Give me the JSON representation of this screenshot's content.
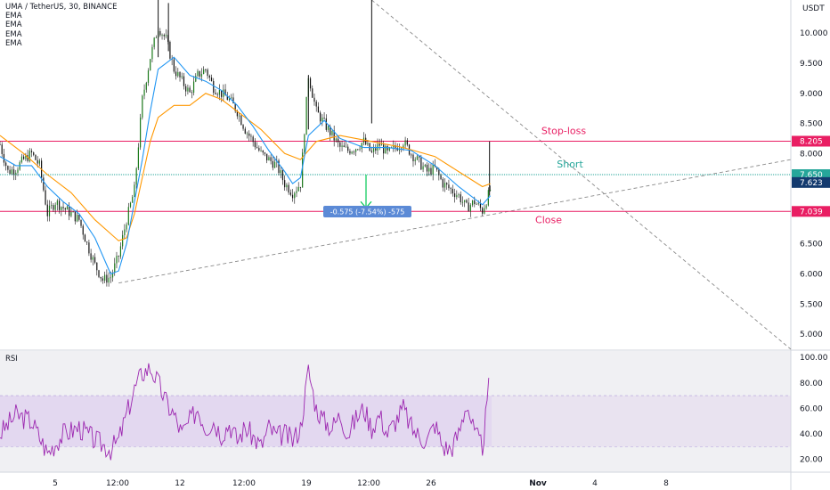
{
  "header": {
    "symbol": "UMA / TetherUS, 30, BINANCE",
    "indicators": [
      "EMA",
      "EMA",
      "EMA",
      "EMA"
    ],
    "currency": "USDT"
  },
  "rsi_panel": {
    "label": "RSI"
  },
  "colors": {
    "candle": "#111111",
    "ema_fast": "#2196f3",
    "ema_slow": "#ff9800",
    "line_red": "#e91e63",
    "line_teal": "#26a69a",
    "rsi_line": "#9c27b0",
    "rsi_band": "#e1d3ee",
    "arrow_green": "#00c853",
    "measure_box": "#5b8ad6",
    "label_dark_blue": "#133a6e"
  },
  "chart_data": [
    {
      "type": "candlestick",
      "title": "UMA / TetherUS, 30, BINANCE",
      "ylabel": "USDT",
      "ylim": [
        4.75,
        10.55
      ],
      "y_ticks": [
        "10.000",
        "9.500",
        "9.000",
        "8.500",
        "8.000",
        "7.500",
        "7.000",
        "6.500",
        "6.000",
        "5.500",
        "5.000"
      ],
      "x_tick_labels": [
        "5",
        "12:00",
        "12",
        "12:00",
        "19",
        "12:00",
        "26",
        "Nov",
        "4",
        "8"
      ],
      "price_path": [
        {
          "t": 0,
          "p": 8.15
        },
        {
          "t": 1,
          "p": 7.7
        },
        {
          "t": 2,
          "p": 7.75
        },
        {
          "t": 3,
          "p": 7.9
        },
        {
          "t": 4,
          "p": 8.0
        },
        {
          "t": 5,
          "p": 7.8
        },
        {
          "t": 6,
          "p": 7.0
        },
        {
          "t": 7,
          "p": 7.2
        },
        {
          "t": 8,
          "p": 7.1
        },
        {
          "t": 9,
          "p": 7.0
        },
        {
          "t": 10,
          "p": 6.9
        },
        {
          "t": 11,
          "p": 6.5
        },
        {
          "t": 12,
          "p": 6.15
        },
        {
          "t": 13,
          "p": 5.9
        },
        {
          "t": 14,
          "p": 5.95
        },
        {
          "t": 15,
          "p": 6.3
        },
        {
          "t": 16,
          "p": 6.9
        },
        {
          "t": 17,
          "p": 7.4
        },
        {
          "t": 18,
          "p": 8.9
        },
        {
          "t": 19,
          "p": 9.6
        },
        {
          "t": 20,
          "p": 10.1
        },
        {
          "t": 21,
          "p": 9.9
        },
        {
          "t": 22,
          "p": 9.4
        },
        {
          "t": 23,
          "p": 9.2
        },
        {
          "t": 24,
          "p": 9.0
        },
        {
          "t": 25,
          "p": 9.3
        },
        {
          "t": 26,
          "p": 9.4
        },
        {
          "t": 27,
          "p": 9.1
        },
        {
          "t": 28,
          "p": 9.0
        },
        {
          "t": 29,
          "p": 8.9
        },
        {
          "t": 30,
          "p": 8.7
        },
        {
          "t": 31,
          "p": 8.4
        },
        {
          "t": 32,
          "p": 8.2
        },
        {
          "t": 33,
          "p": 8.0
        },
        {
          "t": 34,
          "p": 7.9
        },
        {
          "t": 35,
          "p": 7.8
        },
        {
          "t": 36,
          "p": 7.5
        },
        {
          "t": 37,
          "p": 7.35
        },
        {
          "t": 38,
          "p": 7.5
        },
        {
          "t": 39,
          "p": 9.3
        },
        {
          "t": 40,
          "p": 8.7
        },
        {
          "t": 41,
          "p": 8.5
        },
        {
          "t": 42,
          "p": 8.3
        },
        {
          "t": 43,
          "p": 8.1
        },
        {
          "t": 44,
          "p": 8.05
        },
        {
          "t": 45,
          "p": 8.1
        },
        {
          "t": 46,
          "p": 8.2
        },
        {
          "t": 47,
          "p": 8.0
        },
        {
          "t": 48,
          "p": 8.15
        },
        {
          "t": 49,
          "p": 8.0
        },
        {
          "t": 50,
          "p": 8.1
        },
        {
          "t": 51,
          "p": 8.2
        },
        {
          "t": 52,
          "p": 8.0
        },
        {
          "t": 53,
          "p": 7.85
        },
        {
          "t": 54,
          "p": 7.7
        },
        {
          "t": 55,
          "p": 7.75
        },
        {
          "t": 56,
          "p": 7.5
        },
        {
          "t": 57,
          "p": 7.4
        },
        {
          "t": 58,
          "p": 7.3
        },
        {
          "t": 59,
          "p": 7.1
        },
        {
          "t": 60,
          "p": 7.2
        },
        {
          "t": 61,
          "p": 7.05
        },
        {
          "t": 62,
          "p": 7.4
        }
      ],
      "ema_fast": [
        {
          "t": 0,
          "p": 7.95
        },
        {
          "t": 2,
          "p": 7.8
        },
        {
          "t": 4,
          "p": 7.8
        },
        {
          "t": 6,
          "p": 7.45
        },
        {
          "t": 8,
          "p": 7.2
        },
        {
          "t": 10,
          "p": 7.0
        },
        {
          "t": 12,
          "p": 6.6
        },
        {
          "t": 14,
          "p": 6.0
        },
        {
          "t": 15,
          "p": 6.05
        },
        {
          "t": 16,
          "p": 6.5
        },
        {
          "t": 17,
          "p": 7.2
        },
        {
          "t": 18,
          "p": 7.9
        },
        {
          "t": 19,
          "p": 8.7
        },
        {
          "t": 20,
          "p": 9.4
        },
        {
          "t": 22,
          "p": 9.6
        },
        {
          "t": 24,
          "p": 9.3
        },
        {
          "t": 26,
          "p": 9.2
        },
        {
          "t": 28,
          "p": 9.05
        },
        {
          "t": 30,
          "p": 8.8
        },
        {
          "t": 32,
          "p": 8.45
        },
        {
          "t": 34,
          "p": 8.05
        },
        {
          "t": 36,
          "p": 7.7
        },
        {
          "t": 37,
          "p": 7.5
        },
        {
          "t": 38,
          "p": 7.6
        },
        {
          "t": 39,
          "p": 8.3
        },
        {
          "t": 41,
          "p": 8.55
        },
        {
          "t": 43,
          "p": 8.25
        },
        {
          "t": 46,
          "p": 8.1
        },
        {
          "t": 49,
          "p": 8.1
        },
        {
          "t": 52,
          "p": 8.05
        },
        {
          "t": 55,
          "p": 7.8
        },
        {
          "t": 58,
          "p": 7.45
        },
        {
          "t": 61,
          "p": 7.15
        },
        {
          "t": 62,
          "p": 7.3
        }
      ],
      "ema_slow": [
        {
          "t": 0,
          "p": 8.3
        },
        {
          "t": 3,
          "p": 8.0
        },
        {
          "t": 6,
          "p": 7.65
        },
        {
          "t": 9,
          "p": 7.35
        },
        {
          "t": 12,
          "p": 6.9
        },
        {
          "t": 15,
          "p": 6.55
        },
        {
          "t": 16,
          "p": 6.6
        },
        {
          "t": 17,
          "p": 7.0
        },
        {
          "t": 18,
          "p": 7.6
        },
        {
          "t": 19,
          "p": 8.2
        },
        {
          "t": 20,
          "p": 8.6
        },
        {
          "t": 22,
          "p": 8.8
        },
        {
          "t": 24,
          "p": 8.8
        },
        {
          "t": 26,
          "p": 9.0
        },
        {
          "t": 28,
          "p": 8.9
        },
        {
          "t": 30,
          "p": 8.7
        },
        {
          "t": 33,
          "p": 8.4
        },
        {
          "t": 36,
          "p": 8.0
        },
        {
          "t": 38,
          "p": 7.9
        },
        {
          "t": 40,
          "p": 8.2
        },
        {
          "t": 43,
          "p": 8.3
        },
        {
          "t": 47,
          "p": 8.2
        },
        {
          "t": 51,
          "p": 8.1
        },
        {
          "t": 55,
          "p": 7.95
        },
        {
          "t": 58,
          "p": 7.7
        },
        {
          "t": 61,
          "p": 7.45
        },
        {
          "t": 62,
          "p": 7.5
        }
      ],
      "horizontal_levels": [
        {
          "name": "Stop-loss",
          "price": 8.205,
          "label": "8.205"
        },
        {
          "name": "Short",
          "price": 7.65,
          "label": "7.650"
        },
        {
          "name": "Close",
          "price": 7.039,
          "label": "7.039"
        }
      ],
      "price_tags": [
        {
          "label": "7.623",
          "price": 7.623
        }
      ],
      "annotations": [
        {
          "text": "Stop-loss",
          "price": 8.205
        },
        {
          "text": "Short",
          "price": 7.65
        },
        {
          "text": "Close",
          "price": 7.039
        }
      ],
      "measure": {
        "text": "-0.575 (-7.54%) -575",
        "from_price": 7.65,
        "to_price": 7.039
      },
      "trendlines": [
        {
          "name": "support",
          "from": {
            "t": 15,
            "p": 5.85
          },
          "to": {
            "t": 100,
            "p": 7.9
          }
        },
        {
          "name": "resistance",
          "from": {
            "t": 47,
            "p": 10.55
          },
          "to": {
            "t": 100,
            "p": 4.75
          }
        }
      ]
    },
    {
      "type": "line",
      "title": "RSI",
      "ylim": [
        10,
        105
      ],
      "y_ticks": [
        "100.00",
        "80.00",
        "60.00",
        "40.00",
        "20.00"
      ],
      "band": [
        30,
        70
      ],
      "values": [
        {
          "t": 0,
          "v": 40
        },
        {
          "t": 2,
          "v": 55
        },
        {
          "t": 4,
          "v": 50
        },
        {
          "t": 6,
          "v": 25
        },
        {
          "t": 8,
          "v": 40
        },
        {
          "t": 10,
          "v": 45
        },
        {
          "t": 12,
          "v": 35
        },
        {
          "t": 14,
          "v": 28
        },
        {
          "t": 15,
          "v": 35
        },
        {
          "t": 16,
          "v": 55
        },
        {
          "t": 17,
          "v": 75
        },
        {
          "t": 18,
          "v": 88
        },
        {
          "t": 19,
          "v": 92
        },
        {
          "t": 20,
          "v": 80
        },
        {
          "t": 21,
          "v": 65
        },
        {
          "t": 22,
          "v": 55
        },
        {
          "t": 23,
          "v": 40
        },
        {
          "t": 24,
          "v": 50
        },
        {
          "t": 25,
          "v": 60
        },
        {
          "t": 26,
          "v": 45
        },
        {
          "t": 27,
          "v": 50
        },
        {
          "t": 28,
          "v": 40
        },
        {
          "t": 29,
          "v": 48
        },
        {
          "t": 30,
          "v": 35
        },
        {
          "t": 31,
          "v": 45
        },
        {
          "t": 32,
          "v": 38
        },
        {
          "t": 33,
          "v": 30
        },
        {
          "t": 34,
          "v": 45
        },
        {
          "t": 35,
          "v": 38
        },
        {
          "t": 36,
          "v": 40
        },
        {
          "t": 37,
          "v": 35
        },
        {
          "t": 38,
          "v": 45
        },
        {
          "t": 39,
          "v": 90
        },
        {
          "t": 40,
          "v": 60
        },
        {
          "t": 41,
          "v": 50
        },
        {
          "t": 42,
          "v": 45
        },
        {
          "t": 43,
          "v": 55
        },
        {
          "t": 44,
          "v": 40
        },
        {
          "t": 45,
          "v": 52
        },
        {
          "t": 46,
          "v": 60
        },
        {
          "t": 47,
          "v": 45
        },
        {
          "t": 48,
          "v": 55
        },
        {
          "t": 49,
          "v": 40
        },
        {
          "t": 50,
          "v": 50
        },
        {
          "t": 51,
          "v": 60
        },
        {
          "t": 52,
          "v": 45
        },
        {
          "t": 53,
          "v": 38
        },
        {
          "t": 54,
          "v": 35
        },
        {
          "t": 55,
          "v": 48
        },
        {
          "t": 56,
          "v": 30
        },
        {
          "t": 57,
          "v": 28
        },
        {
          "t": 58,
          "v": 40
        },
        {
          "t": 59,
          "v": 65
        },
        {
          "t": 60,
          "v": 40
        },
        {
          "t": 61,
          "v": 30
        },
        {
          "t": 62,
          "v": 84
        }
      ]
    }
  ]
}
